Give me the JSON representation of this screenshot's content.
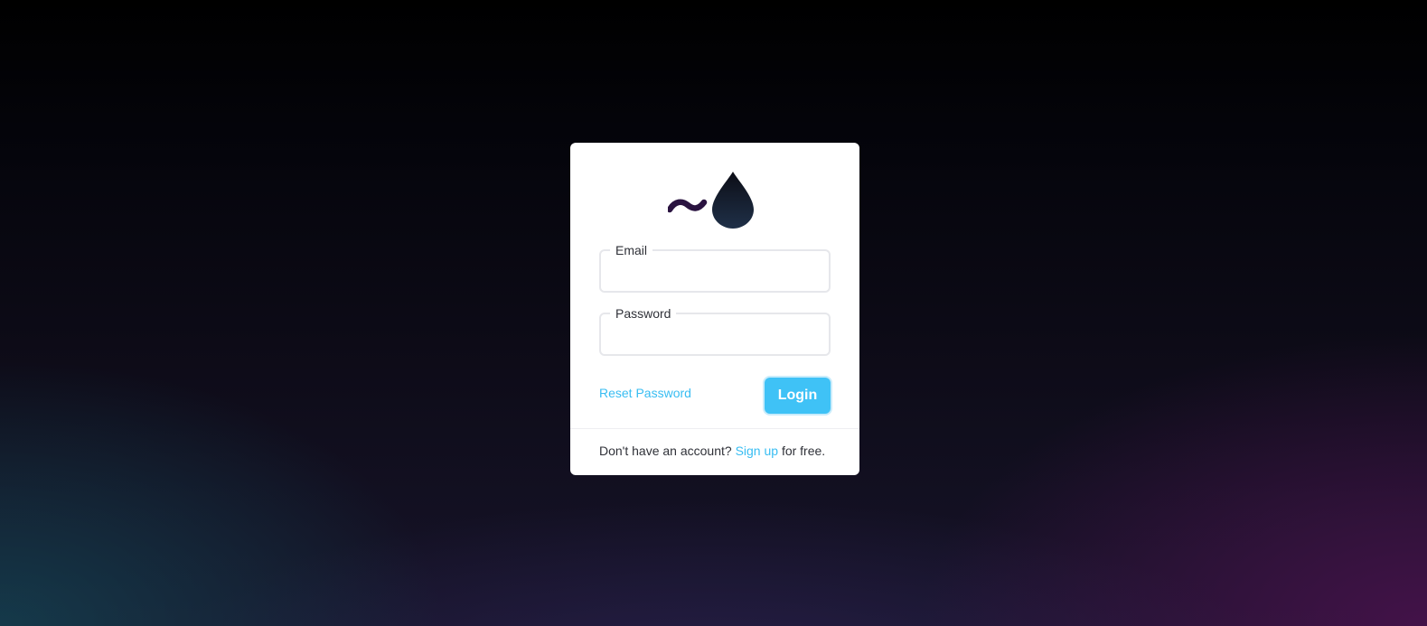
{
  "logo": {
    "icon": "drop-logo-icon",
    "tilde": "~"
  },
  "form": {
    "email": {
      "label": "Email",
      "value": "",
      "placeholder": ""
    },
    "password": {
      "label": "Password",
      "value": "",
      "placeholder": ""
    },
    "reset_link": "Reset Password",
    "login_button": "Login"
  },
  "footer": {
    "prefix": "Don't have an account?",
    "signup_link": "Sign up",
    "suffix": "for free."
  },
  "colors": {
    "accent": "#3fc2f6",
    "link": "#38bdf2",
    "logo_dark": "#2a1340"
  }
}
